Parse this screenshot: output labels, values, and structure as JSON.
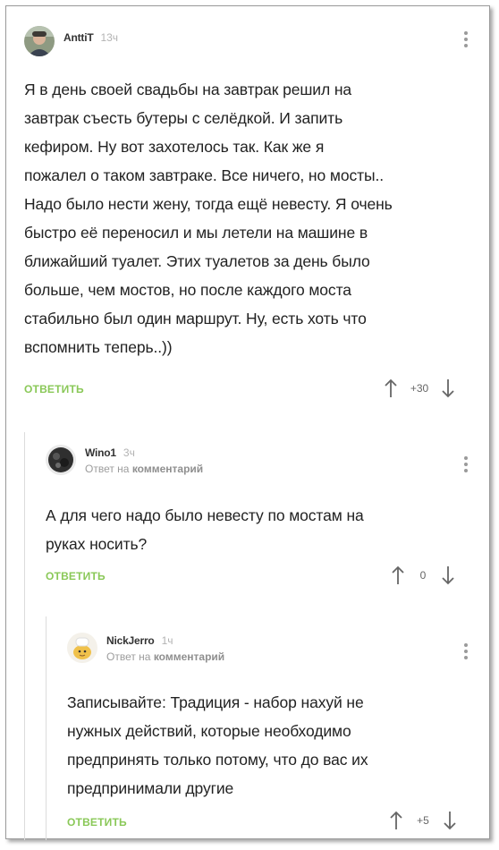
{
  "comments": [
    {
      "author": "AnttiT",
      "time": "13ч",
      "text_lines": [
        "Я в день своей свадьбы на завтрак решил на",
        "завтрак съесть бутеры с селёдкой. И запить",
        "кефиром. Ну вот захотелось так. Как же я",
        "пожалел о таком завтраке. Все ничего, но мосты..",
        "Надо было нести жену, тогда ещё невесту. Я очень",
        "быстро её переносил и мы летели на машине в",
        "ближайший туалет. Этих туалетов за день было",
        "больше, чем мостов, но после каждого моста",
        "стабильно был один маршрут. Ну, есть хоть что",
        "вспомнить теперь..))"
      ],
      "reply_label": "ОТВЕТИТЬ",
      "rating": "+30"
    },
    {
      "author": "Wino1",
      "time": "3ч",
      "reply_to_prefix": "Ответ на",
      "reply_to_target": "комментарий",
      "text_lines": [
        "А для чего надо было невесту по мостам на",
        "руках носить?"
      ],
      "reply_label": "ОТВЕТИТЬ",
      "rating": "0"
    },
    {
      "author": "NickJerro",
      "time": "1ч",
      "reply_to_prefix": "Ответ на",
      "reply_to_target": "комментарий",
      "text_lines": [
        "Записывайте: Традиция - набор нахуй не",
        "нужных действий, которые необходимо",
        "предпринять только потому, что до вас их",
        "предпринимали другие"
      ],
      "reply_label": "ОТВЕТИТЬ",
      "rating": "+5"
    }
  ],
  "colors": {
    "accent_green": "#8ac858",
    "text": "#222222",
    "meta_gray": "#9c9c9c"
  }
}
